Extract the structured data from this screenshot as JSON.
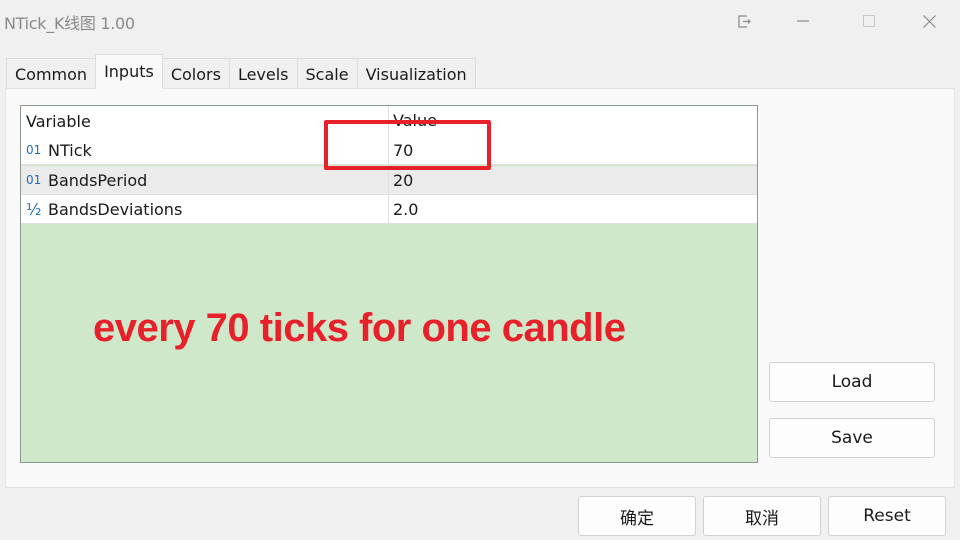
{
  "window": {
    "title": "NTick_K线图 1.00",
    "controls": [
      "restore-export-icon",
      "minimize-icon",
      "maximize-icon",
      "close-icon"
    ]
  },
  "tabs": [
    {
      "label": "Common",
      "active": false
    },
    {
      "label": "Inputs",
      "active": true
    },
    {
      "label": "Colors",
      "active": false
    },
    {
      "label": "Levels",
      "active": false
    },
    {
      "label": "Scale",
      "active": false
    },
    {
      "label": "Visualization",
      "active": false
    }
  ],
  "inputs_table": {
    "columns": [
      "Variable",
      "Value"
    ],
    "rows": [
      {
        "type_icon": "01",
        "type": "integer",
        "variable": "NTick",
        "value": "70"
      },
      {
        "type_icon": "01",
        "type": "integer",
        "variable": "BandsPeriod",
        "value": "20"
      },
      {
        "type_icon": "½",
        "type": "double",
        "variable": "BandsDeviations",
        "value": "2.0"
      }
    ]
  },
  "annotation": {
    "text": "every 70 ticks for one candle",
    "color": "#e8202a"
  },
  "side_buttons": {
    "load": "Load",
    "save": "Save"
  },
  "footer_buttons": {
    "ok": "确定",
    "cancel": "取消",
    "reset": "Reset"
  },
  "colors": {
    "grid_background": "#cfe8ca",
    "type_icon": "#1d6fb8",
    "highlight": "#e8202a"
  }
}
